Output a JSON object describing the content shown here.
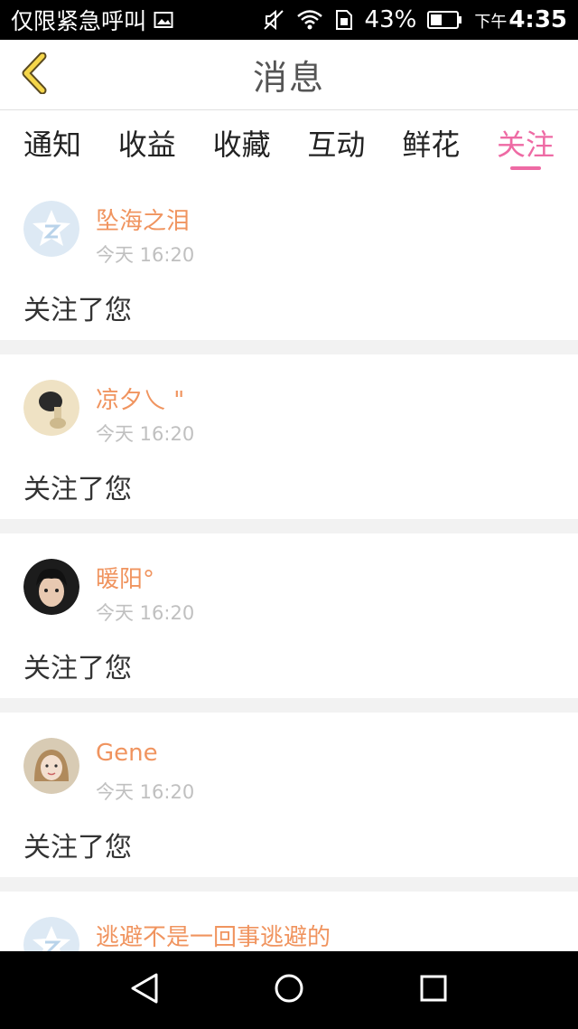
{
  "status_bar": {
    "emergency_text": "仅限紧急呼叫",
    "battery_percent": "43%",
    "time_prefix": "下午",
    "time": "4:35"
  },
  "header": {
    "title": "消息"
  },
  "tabs": [
    {
      "label": "通知"
    },
    {
      "label": "收益"
    },
    {
      "label": "收藏"
    },
    {
      "label": "互动"
    },
    {
      "label": "鲜花"
    },
    {
      "label": "关注"
    }
  ],
  "active_tab": "关注",
  "feed": [
    {
      "name": "坠海之泪",
      "time": "今天 16:20",
      "message": "关注了您",
      "avatar": "default-qzone-avatar"
    },
    {
      "name": "凉夕乀 \"",
      "time": "今天 16:20",
      "message": "关注了您",
      "avatar": "photo-avatar"
    },
    {
      "name": "暖阳°",
      "time": "今天 16:20",
      "message": "关注了您",
      "avatar": "photo-avatar"
    },
    {
      "name": "Gene",
      "time": "今天 16:20",
      "message": "关注了您",
      "avatar": "photo-avatar"
    },
    {
      "name": "逃避不是一回事逃避的",
      "time": "",
      "message": "",
      "avatar": "default-qzone-avatar"
    }
  ],
  "colors": {
    "accent_pink": "#ee6aa4",
    "name_orange": "#f0945f",
    "back_arrow_yellow": "#f5d64a"
  }
}
